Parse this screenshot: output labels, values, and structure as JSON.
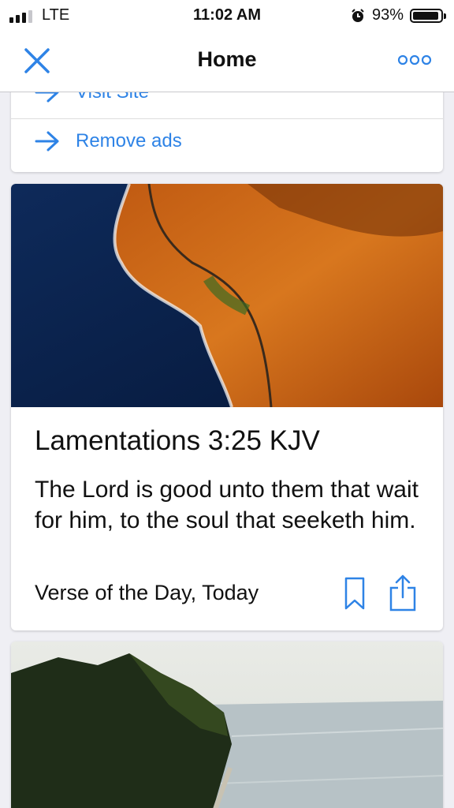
{
  "status_bar": {
    "carrier": "LTE",
    "time": "11:02 AM",
    "battery_percent": "93%",
    "battery_level": 0.93
  },
  "nav": {
    "title": "Home",
    "close_icon": "close-icon",
    "more_icon": "more-icon"
  },
  "links": {
    "visit_site": "Visit Site",
    "remove_ads": "Remove ads"
  },
  "verse_card": {
    "reference": "Lamentations 3:25 KJV",
    "text": "The Lord is good unto them that wait for him, to the soul that seeketh him.",
    "footer": "Verse of the Day, Today"
  },
  "colors": {
    "accent": "#2e83e6",
    "background": "#efeff4"
  }
}
